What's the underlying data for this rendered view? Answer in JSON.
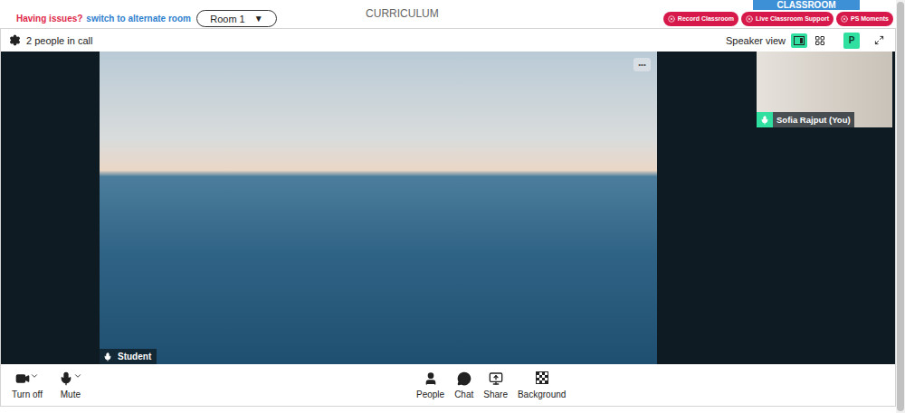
{
  "top_bar": {
    "issue_text": "Having issues?",
    "switch_link": "switch to alternate room",
    "room_select": {
      "value": "Room 1",
      "arrow": "▼"
    },
    "title": "CURRICULUM",
    "classroom_tab": "CLASSROOM",
    "buttons": [
      "Record Classroom",
      "Live Classroom Support",
      "PS Moments"
    ]
  },
  "call_bar": {
    "people_count": "2 people in call",
    "view_label": "Speaker view",
    "layouts": [
      {
        "kind": "speaker",
        "selected": true
      },
      {
        "kind": "grid",
        "selected": false
      }
    ],
    "avatar": "P"
  },
  "main_video": {
    "name": "Student",
    "mic_on": true,
    "menu": "•••"
  },
  "self_view": {
    "name": "Sofia Rajput (You)",
    "mic_on": true
  },
  "toolbar": {
    "left": [
      {
        "label": "Turn off",
        "kind": "camera",
        "on": true
      },
      {
        "label": "Mute",
        "kind": "mic",
        "on": true
      }
    ],
    "center": [
      {
        "label": "People",
        "kind": "people"
      },
      {
        "label": "Chat",
        "kind": "chat"
      },
      {
        "label": "Share",
        "kind": "share"
      },
      {
        "label": "Background",
        "kind": "background"
      }
    ]
  }
}
